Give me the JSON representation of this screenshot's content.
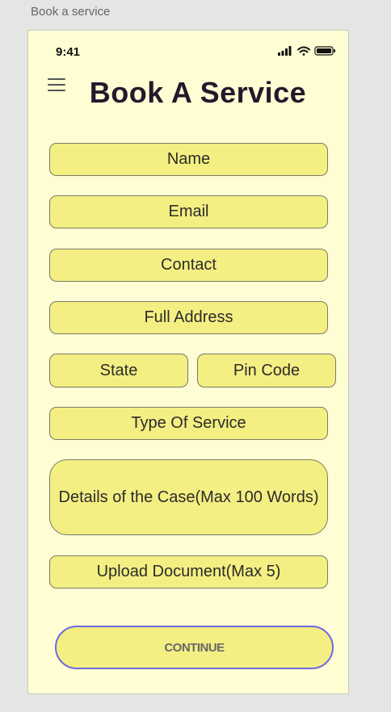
{
  "canvas": {
    "label": "Book a service"
  },
  "status_bar": {
    "time": "9:41"
  },
  "header": {
    "title": "Book A Service"
  },
  "form": {
    "name": "Name",
    "email": "Email",
    "contact": "Contact",
    "address": "Full Address",
    "state": "State",
    "pin_code": "Pin Code",
    "service_type": "Type Of Service",
    "details": "Details of the Case(Max 100 Words)",
    "upload": "Upload Document(Max 5)"
  },
  "actions": {
    "continue_label": "CONTINUE"
  },
  "colors": {
    "artboard_bg": "#fefdd4",
    "field_bg": "#f4ef82",
    "title": "#23192c",
    "button_border": "#6f6ae0"
  }
}
